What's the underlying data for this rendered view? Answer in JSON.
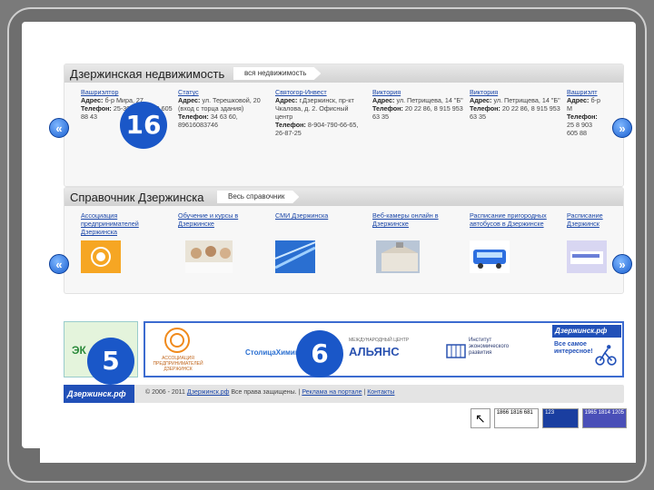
{
  "realty": {
    "title": "Дзержинская недвижимость",
    "link": "вся недвижимость",
    "cards": [
      {
        "title": "Вашриэлтор",
        "address_label": "Адрес:",
        "address": "б-р Мира, 27",
        "phone_label": "Телефон:",
        "phone": "25-30-40, 8 903 605 88 43"
      },
      {
        "title": "Статус",
        "address_label": "Адрес:",
        "address": "ул. Терешковой, 20 (вход с торца здания)",
        "phone_label": "Телефон:",
        "phone": "34 63 60, 89616083746"
      },
      {
        "title": "Святогор-Инвест",
        "address_label": "Адрес:",
        "address": "г.Дзержинск, пр-кт Чкалова, д. 2. Офисный центр",
        "phone_label": "Телефон:",
        "phone": "8-904-790-66-65, 26-87-25"
      },
      {
        "title": "Виктория",
        "address_label": "Адрес:",
        "address": "ул. Петрищева, 14 \"Б\"",
        "phone_label": "Телефон:",
        "phone": "20 22 86, 8 915 953 63 35"
      },
      {
        "title": "Виктория",
        "address_label": "Адрес:",
        "address": "ул. Петрищева, 14 \"Б\"",
        "phone_label": "Телефон:",
        "phone": "20 22 86, 8 915 953 63 35"
      },
      {
        "title": "Вашриэлт",
        "address_label": "Адрес:",
        "address": "б-р М",
        "phone_label": "Телефон:",
        "phone": "25 8 903 605 88"
      }
    ]
  },
  "directory": {
    "title": "Справочник Дзержинска",
    "link": "Весь справочник",
    "cards": [
      {
        "title": "Ассоциация предпринимателей Дзержинска",
        "thumb": "association-logo"
      },
      {
        "title": "Обучение и курсы в Дзержинске",
        "thumb": "people-photo"
      },
      {
        "title": "СМИ Дзержинска",
        "thumb": "media-photo"
      },
      {
        "title": "Веб-камеры онлайн в Дзержинске",
        "thumb": "building-photo"
      },
      {
        "title": "Расписание пригородных автобусов в Дзержинске",
        "thumb": "bus-photo"
      },
      {
        "title": "Расписание Дзержинск",
        "thumb": "train-photo"
      }
    ]
  },
  "badges": {
    "a": "16",
    "b": "5",
    "c": "6"
  },
  "arrows": {
    "left": "«",
    "right": "»"
  },
  "banners": {
    "left_text": "ЭК",
    "assoc_text": "АССОЦИАЦИЯ ПРЕДПРИНИМАТЕЛЕЙ ДЗЕРЖИНСК",
    "capital_text": "СтолицаХимии.рф",
    "alliance_small": "МЕЖДУНАРОДНЫЙ ЦЕНТР",
    "alliance_text": "АЛЬЯНС",
    "institute_text": "Институт экономического развития",
    "promo_site": "Дзержинск.рф",
    "promo_text": "Все самое интересное!"
  },
  "footer": {
    "logo": "Дзержинск.рф",
    "copyright": "© 2006 - 2011 ",
    "site": "Дзержинск.рф",
    "rights": " Все права защищены. | ",
    "ads": "Реклама на портале",
    "sep": " | ",
    "contacts": "Контакты"
  },
  "counters": {
    "c1": "1866 1816 681",
    "c2": "123",
    "c3": "1965 1814 1205"
  },
  "colors": {
    "accent": "#1a57c8",
    "link": "#1a46a8"
  }
}
